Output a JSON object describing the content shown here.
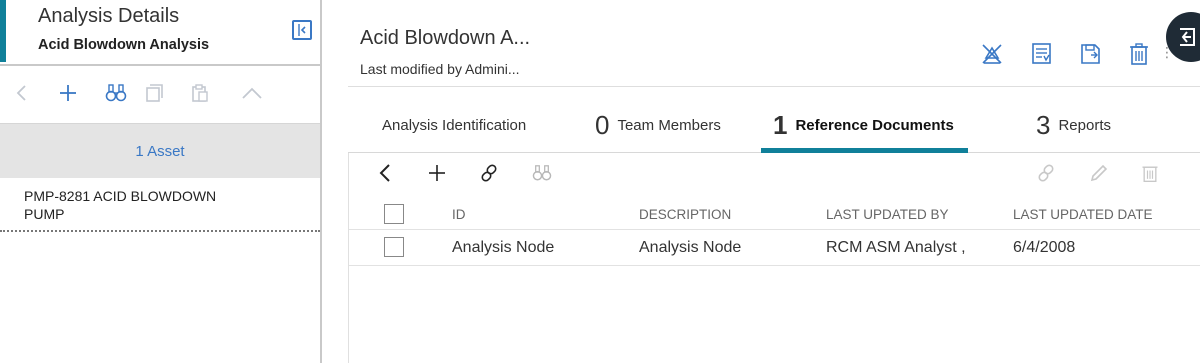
{
  "left_panel": {
    "title": "Analysis Details",
    "subtitle": "Acid Blowdown Analysis",
    "toolbar": [
      "back-icon",
      "add-icon",
      "binoculars-icon",
      "copy-icon",
      "paste-icon",
      "chevron-up-icon"
    ],
    "asset_header": "1 Asset",
    "asset_item": "PMP-8281 ACID BLOWDOWN PUMP"
  },
  "header": {
    "title": "Acid Blowdown A...",
    "subtitle": "Last modified by Admini...",
    "actions": [
      "hierarchy-icon",
      "report-icon",
      "save-icon",
      "delete-icon"
    ]
  },
  "tabs": [
    {
      "count": "",
      "label": "Analysis Identification",
      "active": false
    },
    {
      "count": "0",
      "label": "Team Members",
      "active": false
    },
    {
      "count": "1",
      "label": "Reference Documents",
      "active": true
    },
    {
      "count": "3",
      "label": "Reports",
      "active": false
    }
  ],
  "grid": {
    "toolbar_left": [
      "back-icon",
      "add-icon",
      "link-icon",
      "binoculars-icon"
    ],
    "toolbar_right": [
      "unlink-icon",
      "edit-icon",
      "delete-icon"
    ],
    "columns": [
      "ID",
      "DESCRIPTION",
      "LAST UPDATED BY",
      "LAST UPDATED DATE"
    ],
    "rows": [
      {
        "id": "Analysis Node",
        "description": "Analysis Node",
        "last_updated_by": "RCM ASM Analyst ,",
        "last_updated_date": "6/4/2008"
      }
    ]
  },
  "colors": {
    "accent": "#10809a",
    "link_blue": "#3a78c5",
    "icon_blue": "#3a78c5",
    "dark_floater": "#1f2b36"
  }
}
